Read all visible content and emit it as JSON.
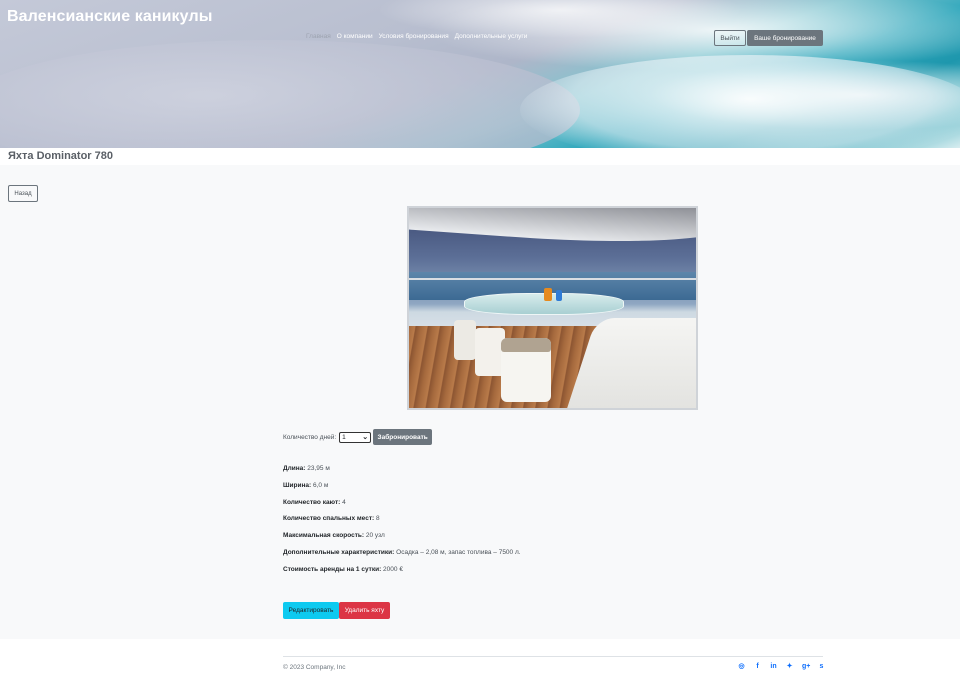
{
  "header": {
    "brand": "Валенсианские каникулы",
    "nav": [
      {
        "label": "Главная",
        "active": true
      },
      {
        "label": "О компании",
        "active": false
      },
      {
        "label": "Условия бронирования",
        "active": false
      },
      {
        "label": "Дополнительные услуги",
        "active": false
      }
    ],
    "login_label": "Выйти",
    "booking_label": "Ваше бронирование"
  },
  "page": {
    "title": "Яхта Dominator 780",
    "back_label": "Назад"
  },
  "booking": {
    "days_label": "Количество дней:",
    "days_value": "1",
    "reserve_label": "Забронировать"
  },
  "specs": [
    {
      "key": "Длина:",
      "value": " 23,95 м"
    },
    {
      "key": "Ширина:",
      "value": " 6,0 м"
    },
    {
      "key": "Количество кают:",
      "value": " 4"
    },
    {
      "key": "Количество спальных мест:",
      "value": " 8"
    },
    {
      "key": "Максимальная скорость:",
      "value": " 20 узл"
    },
    {
      "key": "Дополнительные характеристики:",
      "value": " Осадка – 2,08 м, запас топлива – 7500 л."
    },
    {
      "key": "Стоимость аренды на 1 сутки:",
      "value": " 2000 €"
    }
  ],
  "actions": {
    "edit_label": "Редактировать",
    "delete_label": "Удалить яхту"
  },
  "footer": {
    "copyright": "© 2023 Company, Inc",
    "social_icons": [
      "instagram-icon",
      "facebook-icon",
      "linkedin-icon",
      "twitter-icon",
      "google-plus-icon",
      "skype-icon"
    ],
    "social_glyphs": [
      "◎",
      "f",
      "in",
      "✦",
      "g+",
      "s"
    ]
  },
  "colors": {
    "secondary": "#6c757d",
    "info": "#0dcaf0",
    "danger": "#dc3545",
    "link": "#0d6efd",
    "background": "#f8f9fa"
  }
}
